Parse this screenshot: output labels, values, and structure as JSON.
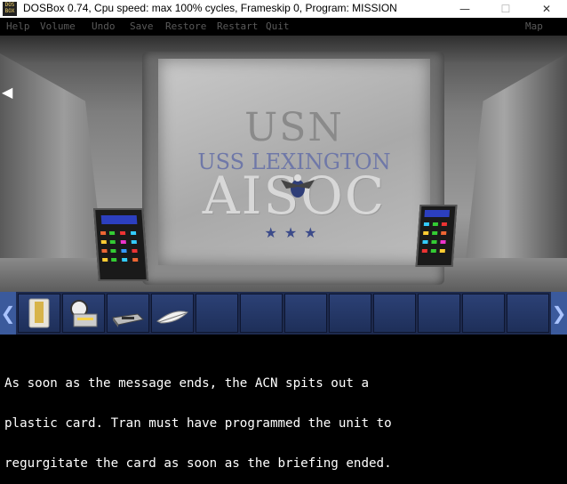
{
  "window": {
    "icon_text": "DOS\nBOX",
    "title": "DOSBox 0.74, Cpu speed: max 100% cycles, Frameskip  0, Program:  MISSION",
    "controls": {
      "minimize": "—",
      "maximize": "☐",
      "close": "✕"
    }
  },
  "menu": {
    "items": [
      "Help",
      "Volume",
      "Undo",
      "Save",
      "Restore",
      "Restart",
      "Quit"
    ],
    "map": "Map"
  },
  "scene": {
    "screen_lines": {
      "line1": "USN",
      "line2": "USS LEXINGTON",
      "line3": "AISOC"
    },
    "stars": "★★★",
    "back_icon": "arrow-left-icon"
  },
  "inventory": {
    "left_arrow": "❮",
    "right_arrow": "❯",
    "items": [
      "plastic-card-icon",
      "camera-icon",
      "device-icon",
      "feather-icon"
    ],
    "slot_count": 12
  },
  "narration": {
    "line1": "As soon as the message ends, the ACN spits out a",
    "line2": "plastic card. Tran must have programmed the unit to",
    "line3": "regurgitate the card as soon as the briefing ended."
  }
}
